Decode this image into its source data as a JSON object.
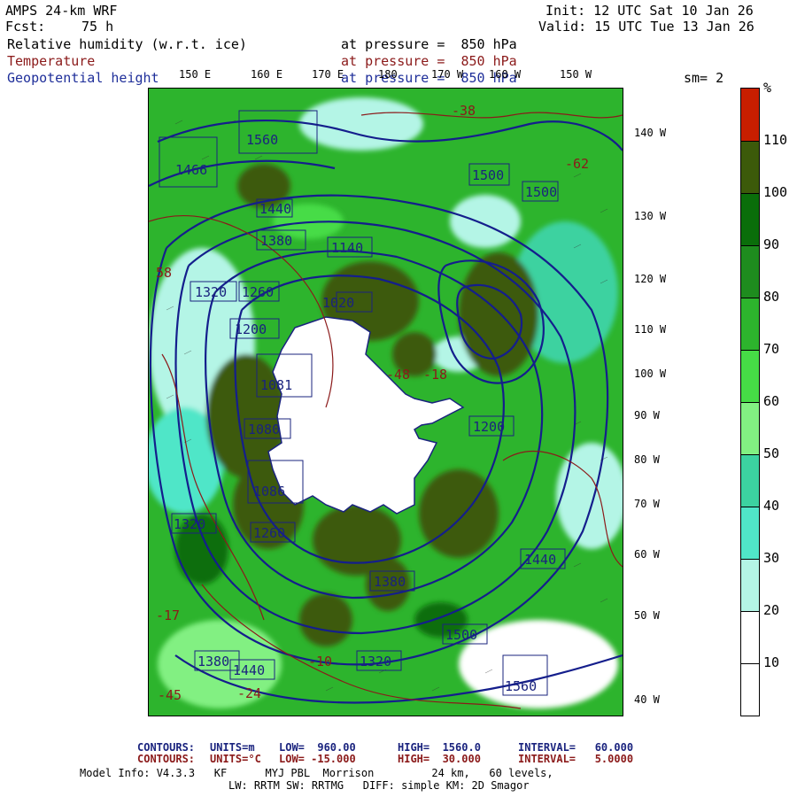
{
  "header": {
    "model": "AMPS 24-km WRF",
    "fcst_label": "Fcst:",
    "fcst_value": "75 h",
    "init": "Init: 12 UTC Sat 10 Jan 26",
    "valid": "Valid: 15 UTC Tue 13 Jan 26",
    "fields": [
      {
        "name": "Relative humidity (w.r.t. ice)",
        "level": "at pressure =  850 hPa"
      },
      {
        "name": "Temperature",
        "level": "at pressure =  850 hPa"
      },
      {
        "name": "Geopotential height",
        "level": "at pressure =  850 hPa"
      }
    ],
    "smoothing": "sm= 2"
  },
  "map": {
    "longitude_labels": [
      "150 E",
      "160 E",
      "170 E",
      "180",
      "170 W",
      "160 W",
      "150 W"
    ],
    "latitude_labels": [
      "140 W",
      "130 W",
      "120 W",
      "110 W",
      "100 W",
      "90 W",
      "80 W",
      "70 W",
      "60 W",
      "50 W",
      "40 W"
    ],
    "height_contour_labels": [
      "1466",
      "1560",
      "1500",
      "1500",
      "1440",
      "1380",
      "1320",
      "1260",
      "1200",
      "1140",
      "1080",
      "1020",
      "1081",
      "1086",
      "1200",
      "1260",
      "1320",
      "1380",
      "1440",
      "1500",
      "1560",
      "1440",
      "1380",
      "1320"
    ],
    "temperature_labels": [
      "-38",
      "-62",
      "58",
      "-48",
      "-18",
      "-10",
      "-17",
      "-24",
      "-45"
    ]
  },
  "colorbar": {
    "unit": "%",
    "ticks": [
      "110",
      "100",
      "90",
      "80",
      "70",
      "60",
      "50",
      "40",
      "30",
      "20",
      "10"
    ],
    "colors": [
      "#c81e00",
      "#3c5a0a",
      "#0a6e0a",
      "#1e8c1e",
      "#2db42d",
      "#46dc46",
      "#82f082",
      "#3cd2a0",
      "#50e6c8",
      "#b4f5e6",
      "#ffffff",
      "#ffffff"
    ]
  },
  "footer": {
    "contour1": {
      "label": "CONTOURS:",
      "units": "UNITS=m",
      "low": "LOW=  960.00",
      "high": "HIGH=  1560.0",
      "interval": "INTERVAL=   60.000"
    },
    "contour2": {
      "label": "CONTOURS:",
      "units": "UNITS=°C",
      "low": "LOW= -15.000",
      "high": "HIGH=  30.000",
      "interval": "INTERVAL=   5.0000"
    },
    "model_info_1": "Model Info: V4.3.3   KF      MYJ PBL  Morrison         24 km,   60 levels,",
    "model_info_2": "LW: RRTM SW: RRTMG   DIFF: simple KM: 2D Smagor"
  }
}
